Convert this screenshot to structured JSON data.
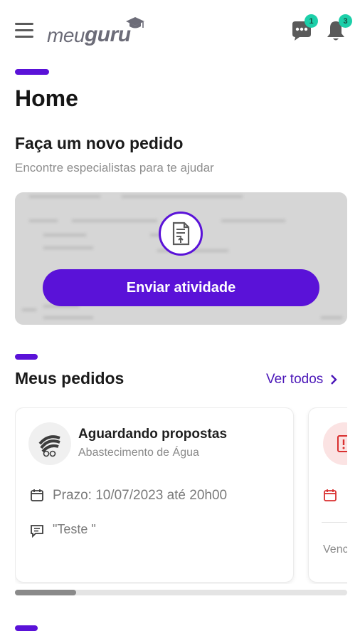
{
  "header": {
    "logo_meu": "meu",
    "logo_guru": "guru",
    "chat_badge": "1",
    "notification_badge": "3"
  },
  "page": {
    "title": "Home"
  },
  "new_order": {
    "title": "Faça um novo pedido",
    "subtitle": "Encontre especialistas para te ajudar",
    "button_label": "Enviar atividade"
  },
  "orders": {
    "title": "Meus pedidos",
    "see_all_label": "Ver todos",
    "items": [
      {
        "status": "Aguardando propostas",
        "subject": "Abastecimento de Água",
        "deadline": "Prazo: 10/07/2023 até 20h00",
        "note": "\"Teste \""
      },
      {
        "partial_text": "Venc"
      }
    ],
    "scroll_position": 0.18
  },
  "colors": {
    "accent": "#5a12d8",
    "badge": "#1ccfa9",
    "link": "#4a16b8",
    "alert": "#d93030"
  },
  "icons": {
    "menu": "menu-icon",
    "chat": "chat-icon",
    "bell": "bell-icon",
    "upload": "document-upload-icon",
    "calendar": "calendar-icon",
    "comment": "comment-icon",
    "chevron": "chevron-right-icon",
    "alert": "alert-icon"
  }
}
